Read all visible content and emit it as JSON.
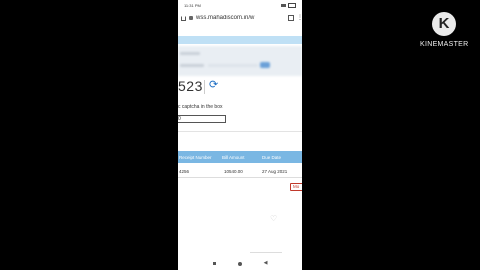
{
  "status_bar": {
    "time": "11:31 PM"
  },
  "browser": {
    "url": "wss.mahadiscom.in/w"
  },
  "captcha": {
    "text": "523",
    "hint": "c captcha in the box",
    "input_value": "0"
  },
  "table": {
    "headers": [
      "Receipt Number",
      "Bill Amount",
      "Due Date"
    ],
    "row": [
      "4256",
      "10540.00",
      "27 Aug 2021"
    ]
  },
  "more_button": "Mo",
  "watermark": {
    "brand": "KINEMASTER",
    "logo_letter": "K"
  }
}
